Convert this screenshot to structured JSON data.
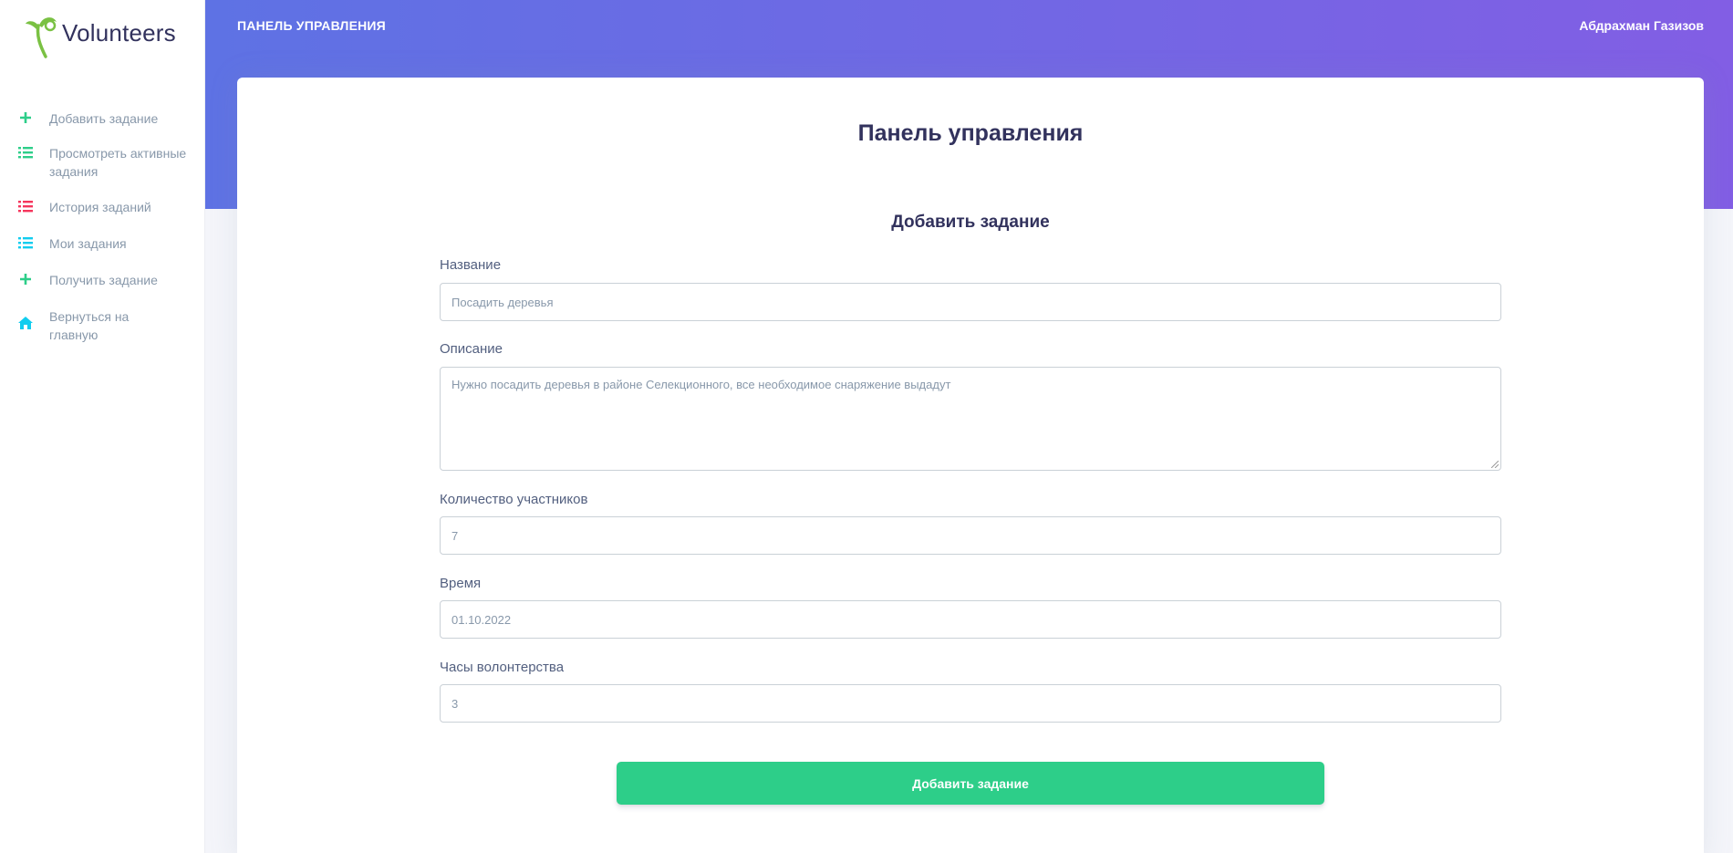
{
  "brand": {
    "name": "Volunteers"
  },
  "sidebar": {
    "items": [
      {
        "label": "Добавить задание",
        "icon": "plus-icon",
        "color": "#2dce89"
      },
      {
        "label": "Просмотреть активные задания",
        "icon": "list-icon",
        "color": "#2dce89"
      },
      {
        "label": "История заданий",
        "icon": "list-icon",
        "color": "#f5365c"
      },
      {
        "label": "Мои задания",
        "icon": "list-icon",
        "color": "#11cdef"
      },
      {
        "label": "Получить задание",
        "icon": "plus-icon",
        "color": "#2dce89"
      },
      {
        "label": "Вернуться на главную",
        "icon": "home-icon",
        "color": "#11cdef"
      }
    ]
  },
  "header": {
    "title": "ПАНЕЛЬ УПРАВЛЕНИЯ",
    "user": "Абдрахман Газизов",
    "gradient": [
      "#5e72e4",
      "#825ee4"
    ]
  },
  "card": {
    "title": "Панель управления",
    "form_title": "Добавить задание"
  },
  "form": {
    "name": {
      "label": "Название",
      "placeholder": "Посадить деревья"
    },
    "description": {
      "label": "Описание",
      "placeholder": "Нужно посадить деревья в районе Селекционного, все необходимое снаряжение выдадут"
    },
    "participants": {
      "label": "Количество участников",
      "value": "7"
    },
    "time": {
      "label": "Время",
      "value": "01.10.2022"
    },
    "hours": {
      "label": "Часы волонтерства",
      "value": "3"
    },
    "submit_label": "Добавить задание",
    "submit_color": "#2dce89"
  }
}
